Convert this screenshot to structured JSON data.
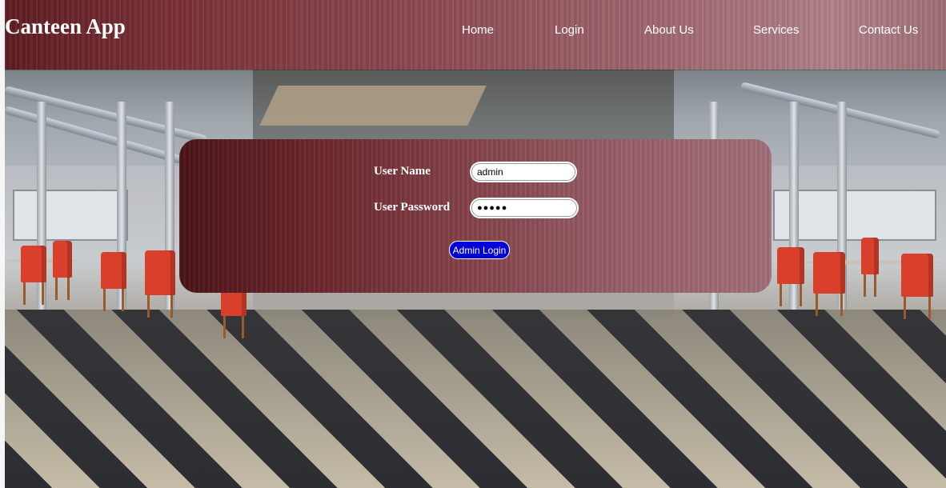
{
  "brand": {
    "title": "Canteen App"
  },
  "nav": {
    "items": [
      {
        "label": "Home"
      },
      {
        "label": "Login"
      },
      {
        "label": "About Us"
      },
      {
        "label": "Services"
      },
      {
        "label": "Contact Us"
      }
    ]
  },
  "login": {
    "username_label": "User Name",
    "username_value": "admin",
    "password_label": "User Password",
    "password_value": "●●●●●",
    "submit_label": "Admin Login"
  },
  "colors": {
    "header_maroon": "#7a3138",
    "button_blue": "#0000d8",
    "text_white": "#ffffff"
  }
}
